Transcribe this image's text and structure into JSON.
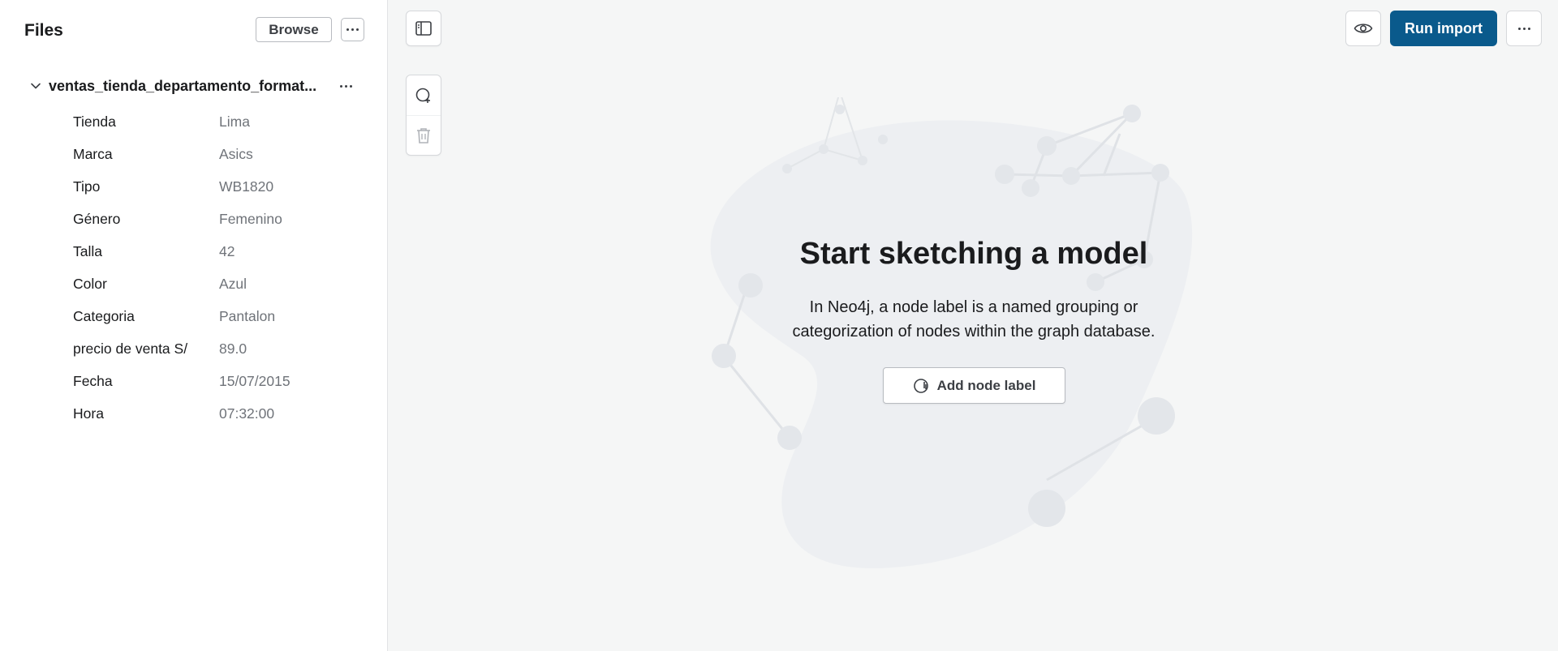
{
  "sidebar": {
    "title": "Files",
    "browse_label": "Browse",
    "file": {
      "name": "ventas_tienda_departamento_format...",
      "properties": [
        {
          "key": "Tienda",
          "value": "Lima"
        },
        {
          "key": "Marca",
          "value": "Asics"
        },
        {
          "key": "Tipo",
          "value": "WB1820"
        },
        {
          "key": "Género",
          "value": "Femenino"
        },
        {
          "key": "Talla",
          "value": "42"
        },
        {
          "key": "Color",
          "value": "Azul"
        },
        {
          "key": "Categoria",
          "value": "Pantalon"
        },
        {
          "key": "precio de venta S/",
          "value": "89.0"
        },
        {
          "key": "Fecha",
          "value": "15/07/2015"
        },
        {
          "key": "Hora",
          "value": "07:32:00"
        }
      ]
    }
  },
  "toolbar": {
    "run_import_label": "Run import",
    "accent": "#0a5a8c"
  },
  "empty_state": {
    "title": "Start sketching a model",
    "description": "In Neo4j, a node label is a named grouping or categorization of nodes within the graph database.",
    "add_label": "Add node label"
  },
  "icons": {
    "sidebar_toggle": "panel-toggle-icon",
    "add_node": "add-node-icon",
    "delete": "trash-icon",
    "preview": "eye-icon",
    "more": "more-horizontal-icon",
    "expand": "chevron-down-icon"
  }
}
